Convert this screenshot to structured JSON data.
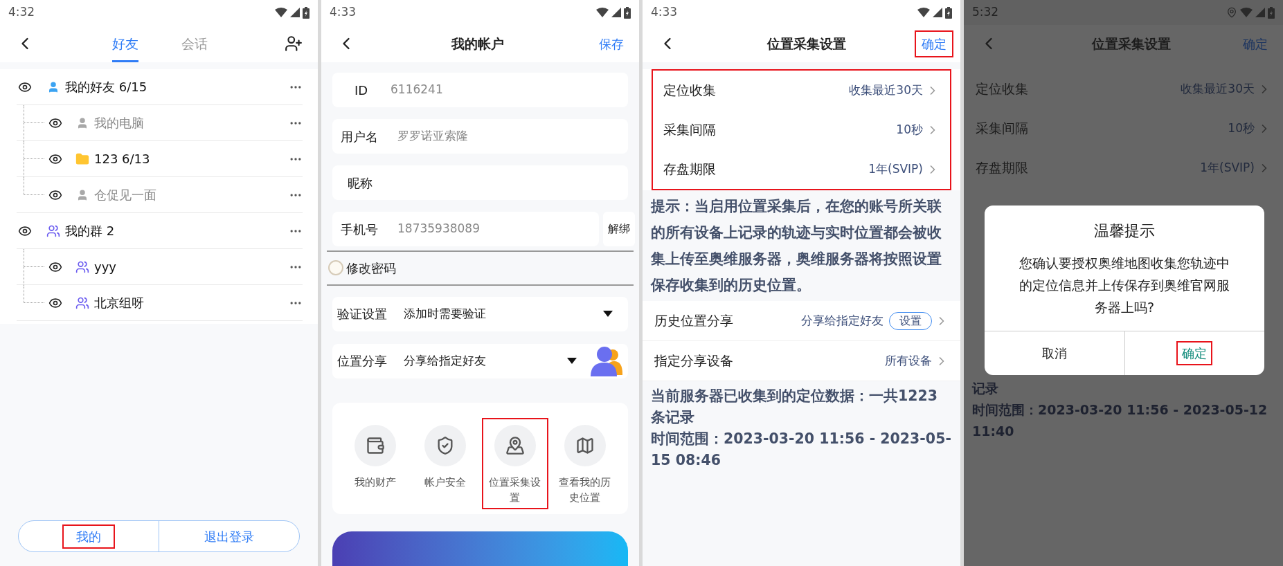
{
  "friends_screen": {
    "status_bar": {
      "time": "4:32",
      "location": false
    },
    "tabs": [
      {
        "label": "好友",
        "selected": true
      },
      {
        "label": "会话",
        "selected": false
      }
    ],
    "tree": [
      {
        "label": "我的好友 6/15",
        "kind": "person",
        "offline": false,
        "children": [
          {
            "label": "我的电脑",
            "kind": "person",
            "offline": true
          },
          {
            "label": "123 6/13",
            "kind": "folder",
            "offline": false
          },
          {
            "label": "仓促见一面",
            "kind": "person",
            "offline": true
          }
        ]
      },
      {
        "label": "我的群 2",
        "kind": "group",
        "offline": false,
        "children": [
          {
            "label": "yyy",
            "kind": "group",
            "offline": false
          },
          {
            "label": "北京组呀",
            "kind": "group",
            "offline": false
          }
        ]
      }
    ],
    "bottom_buttons": [
      {
        "label": "我的",
        "highlighted": true
      },
      {
        "label": "退出登录",
        "highlighted": false
      }
    ]
  },
  "account_screen": {
    "status_bar": {
      "time": "4:33",
      "location": false
    },
    "title": "我的帐户",
    "save": "保存",
    "fields": [
      {
        "label": "ID",
        "value": "6116241"
      },
      {
        "label": "用户名",
        "value": "罗罗诺亚索隆"
      },
      {
        "label": "昵称"
      },
      {
        "label": "手机号",
        "value": "18735938089",
        "action": "解绑"
      }
    ],
    "password_toggle": {
      "label": "修改密码",
      "checked": false
    },
    "selects": [
      {
        "label": "验证设置",
        "value": "添加时需要验证",
        "avatar": false
      },
      {
        "label": "位置分享",
        "value": "分享给指定好友",
        "avatar": true
      }
    ],
    "shortcuts": [
      {
        "label": "我的财产",
        "kind": "wallet",
        "highlighted": false
      },
      {
        "label": "帐户安全",
        "kind": "shield",
        "highlighted": false
      },
      {
        "label": "位置采集设置",
        "kind": "map-pin",
        "highlighted": true
      },
      {
        "label": "查看我的历史位置",
        "kind": "map",
        "highlighted": false
      }
    ]
  },
  "location_settings_screen": {
    "status_bar": {
      "time": "4:33",
      "location": false
    },
    "title": "位置采集设置",
    "confirm": {
      "label": "确定",
      "highlighted": true
    },
    "rows_highlighted": true,
    "rows": [
      {
        "label": "定位收集",
        "value": "收集最近30天"
      },
      {
        "label": "采集间隔",
        "value": "10秒"
      },
      {
        "label": "存盘期限",
        "value": "1年(SVIP)"
      }
    ],
    "hint": "提示：当启用位置采集后，在您的账号所关联的所有设备上记录的轨迹与实时位置都会被收集上传至奥维服务器，奥维服务器将按照设置保存收集到的历史位置。",
    "share_rows": [
      {
        "label": "历史位置分享",
        "value": "分享给指定好友",
        "button": "设置"
      },
      {
        "label": "指定分享设备",
        "value": "所有设备"
      }
    ],
    "stats": [
      "当前服务器已收集到的定位数据：一共1223条记录",
      "时间范围：2023-03-20 11:56 - 2023-05-15 08:46"
    ]
  },
  "dialog_screen": {
    "status_bar": {
      "time": "5:32",
      "location": true
    },
    "title": "位置采集设置",
    "confirm": "确定",
    "rows": [
      {
        "label": "定位收集",
        "value": "收集最近30天"
      },
      {
        "label": "采集间隔",
        "value": "10秒"
      },
      {
        "label": "存盘期限",
        "value": "1年(SVIP)"
      }
    ],
    "stats": [
      "记录",
      "时间范围：2023-03-20 11:56 - 2023-05-12 11:40"
    ],
    "dialog": {
      "title": "温馨提示",
      "message": "您确认要授权奥维地图收集您轨迹中的定位信息并上传保存到奥维官网服务器上吗?",
      "buttons": [
        {
          "label": "取消",
          "kind": "cancel",
          "highlighted": false
        },
        {
          "label": "确定",
          "kind": "confirm",
          "highlighted": true
        }
      ]
    }
  }
}
